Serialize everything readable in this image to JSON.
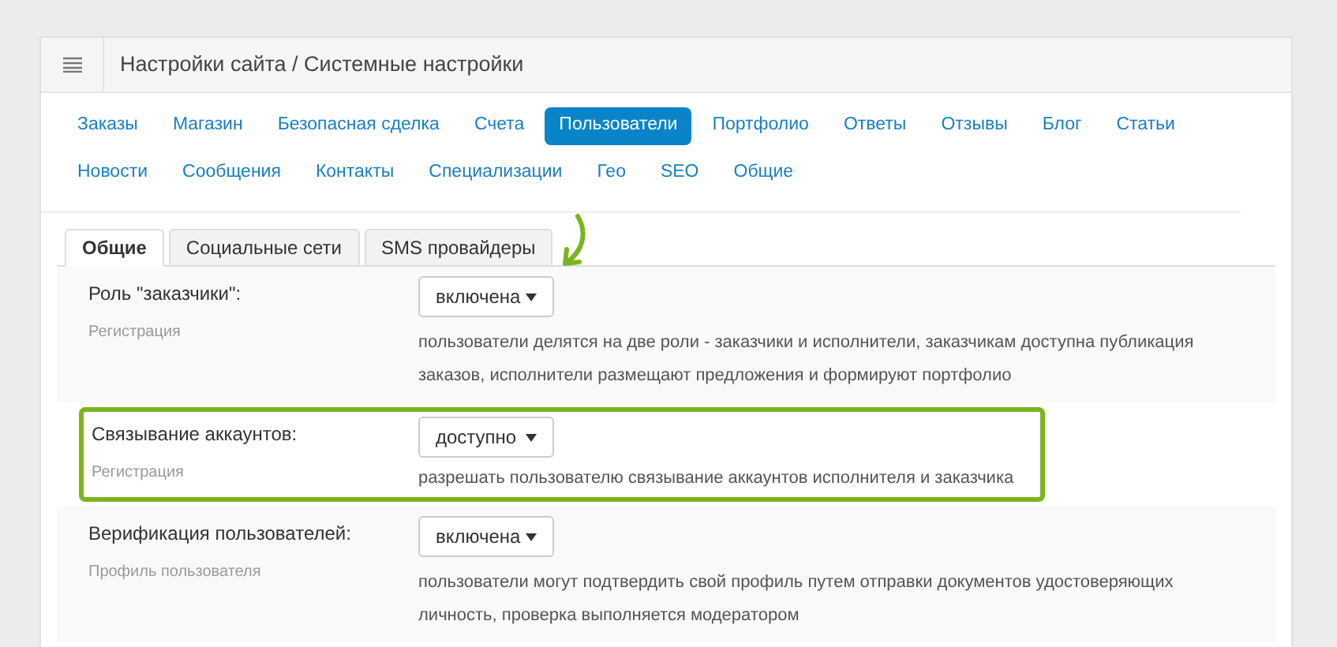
{
  "header": {
    "title": "Настройки сайта / Системные настройки"
  },
  "nav": [
    {
      "label": "Заказы",
      "selected": false
    },
    {
      "label": "Магазин",
      "selected": false
    },
    {
      "label": "Безопасная сделка",
      "selected": false
    },
    {
      "label": "Счета",
      "selected": false
    },
    {
      "label": "Пользователи",
      "selected": true
    },
    {
      "label": "Портфолио",
      "selected": false
    },
    {
      "label": "Ответы",
      "selected": false
    },
    {
      "label": "Отзывы",
      "selected": false
    },
    {
      "label": "Блог",
      "selected": false
    },
    {
      "label": "Статьи",
      "selected": false
    },
    {
      "label": "Новости",
      "selected": false
    },
    {
      "label": "Сообщения",
      "selected": false
    },
    {
      "label": "Контакты",
      "selected": false
    },
    {
      "label": "Специализации",
      "selected": false
    },
    {
      "label": "Гео",
      "selected": false
    },
    {
      "label": "SEO",
      "selected": false
    },
    {
      "label": "Общие",
      "selected": false
    }
  ],
  "tabs": [
    {
      "label": "Общие",
      "selected": true
    },
    {
      "label": "Социальные сети",
      "selected": false
    },
    {
      "label": "SMS провайдеры",
      "selected": false
    }
  ],
  "settings": [
    {
      "label": "Роль \"заказчики\":",
      "group": "Регистрация",
      "value": "включена",
      "description": "пользователи делятся на две роли - заказчики и исполнители, заказчикам доступна публикация заказов, исполнители размещают предложения и формируют портфолио",
      "highlighted": false
    },
    {
      "label": "Связывание аккаунтов:",
      "group": "Регистрация",
      "value": "доступно",
      "description": "разрешать пользователю связывание аккаунтов исполнителя и заказчика",
      "highlighted": true
    },
    {
      "label": "Верификация пользователей:",
      "group": "Профиль пользователя",
      "value": "включена",
      "description": "пользователи могут подтвердить свой профиль путем отправки документов удостоверяющих личность, проверка выполняется модератором",
      "highlighted": false
    }
  ]
}
